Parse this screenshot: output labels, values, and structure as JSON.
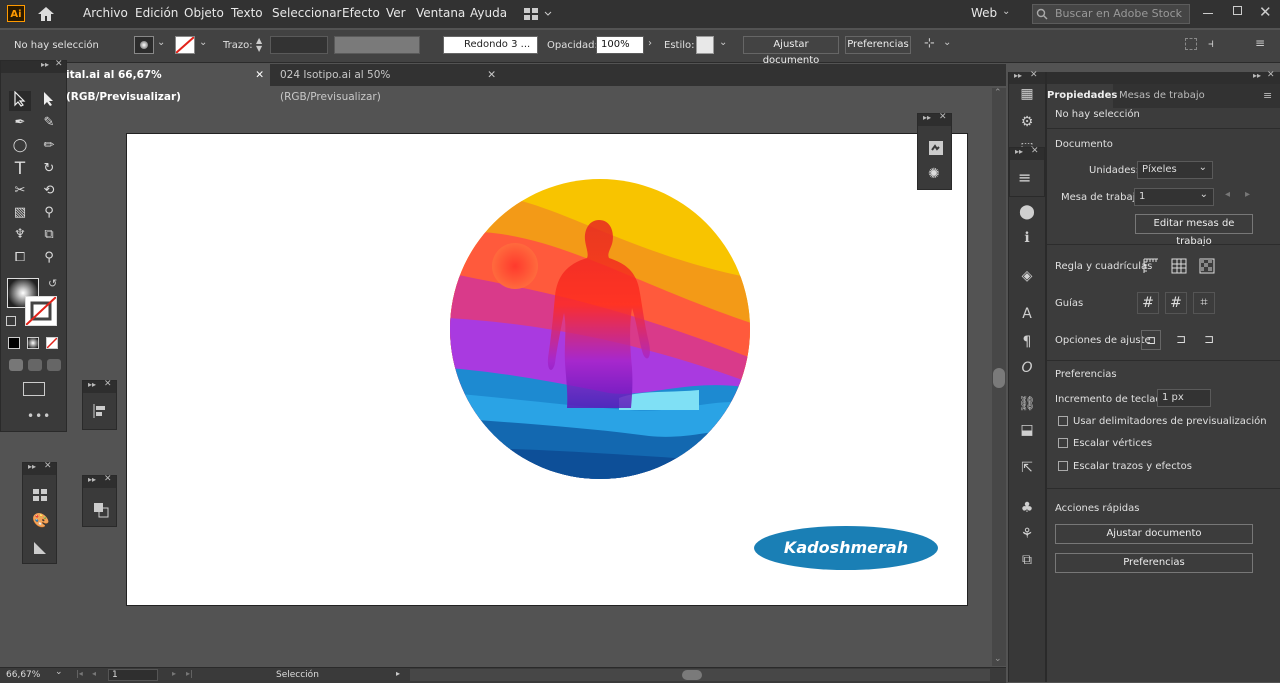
{
  "app": {
    "logo": "Ai"
  },
  "menu": [
    "Archivo",
    "Edición",
    "Objeto",
    "Texto",
    "Seleccionar",
    "Efecto",
    "Ver",
    "Ventana",
    "Ayuda"
  ],
  "workspace": "Web",
  "search_placeholder": "Buscar en Adobe Stock",
  "control": {
    "selection_status": "No hay selección",
    "stroke_label": "Trazo:",
    "brush": "Redondo 3 ...",
    "opacity_label": "Opacidad:",
    "opacity_value": "100%",
    "style_label": "Estilo:",
    "fit_document": "Ajustar documento",
    "preferences": "Preferencias"
  },
  "tabs": [
    {
      "label": "ital.ai al 66,67% (RGB/Previsualizar)",
      "active": true
    },
    {
      "label": "024 Isotipo.ai al 50% (RGB/Previsualizar)",
      "active": false
    }
  ],
  "artwork": {
    "watermark": "Kadoshmerah",
    "badge_color": "#1a7fb5"
  },
  "properties": {
    "tabs": [
      "Propiedades",
      "Mesas de trabajo"
    ],
    "no_selection": "No hay selección",
    "document_title": "Documento",
    "units_label": "Unidades:",
    "units_value": "Píxeles",
    "artboard_label": "Mesa de trabajo:",
    "artboard_value": "1",
    "edit_artboards": "Editar mesas de trabajo",
    "rulers_grids": "Regla y cuadrículas",
    "guides": "Guías",
    "snap_options": "Opciones de ajuste",
    "preferences_title": "Preferencias",
    "keyboard_increment_label": "Incremento de teclado:",
    "keyboard_increment_value": "1 px",
    "checks": [
      "Usar delimitadores de previsualización",
      "Escalar vértices",
      "Escalar trazos y efectos"
    ],
    "quick_actions_title": "Acciones rápidas",
    "quick_fit": "Ajustar documento",
    "quick_prefs": "Preferencias"
  },
  "status": {
    "zoom": "66,67%",
    "artboard": "1",
    "tool": "Selección"
  }
}
